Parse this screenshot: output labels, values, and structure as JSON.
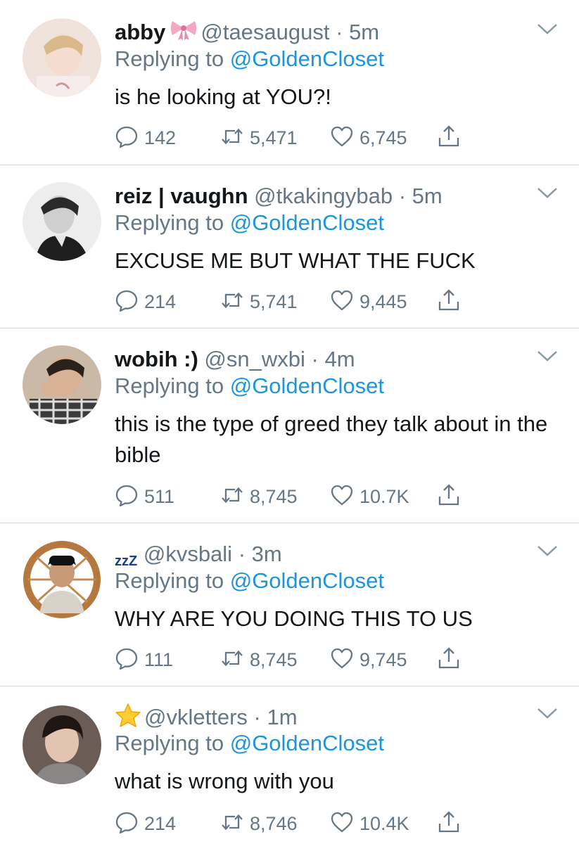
{
  "colors": {
    "link": "#1b95e0",
    "muted": "#657786",
    "text": "#14171a",
    "divider": "#d6d9dc"
  },
  "tweets": [
    {
      "name": "abby",
      "name_emoji": "ribbon-icon",
      "handle": "@taesaugust",
      "time": "5m",
      "replying_prefix": "Replying to",
      "replying_to": "@GoldenCloset",
      "text": "is he looking at YOU?!",
      "replies": "142",
      "retweets": "5,471",
      "likes": "6,745"
    },
    {
      "name": "reiz | vaughn",
      "handle": "@tkakingybab",
      "time": "5m",
      "replying_prefix": "Replying to",
      "replying_to": "@GoldenCloset",
      "text": "EXCUSE ME BUT WHAT THE FUCK",
      "replies": "214",
      "retweets": "5,741",
      "likes": "9,445"
    },
    {
      "name": "wobih :)",
      "handle": "@sn_wxbi",
      "time": "4m",
      "replying_prefix": "Replying to",
      "replying_to": "@GoldenCloset",
      "text": "this is the type of greed they talk about in the bible",
      "replies": "511",
      "retweets": "8,745",
      "likes": "10.7K"
    },
    {
      "name": "zzZ",
      "handle": "@kvsbali",
      "time": "3m",
      "replying_prefix": "Replying to",
      "replying_to": "@GoldenCloset",
      "text": "WHY ARE YOU DOING THIS TO US",
      "replies": "111",
      "retweets": "8,745",
      "likes": "9,745"
    },
    {
      "name": "",
      "name_emoji": "star-icon",
      "handle": "@vkletters",
      "time": "1m",
      "replying_prefix": "Replying to",
      "replying_to": "@GoldenCloset",
      "text": "what is wrong with you",
      "replies": "214",
      "retweets": "8,746",
      "likes": "10.4K"
    }
  ]
}
